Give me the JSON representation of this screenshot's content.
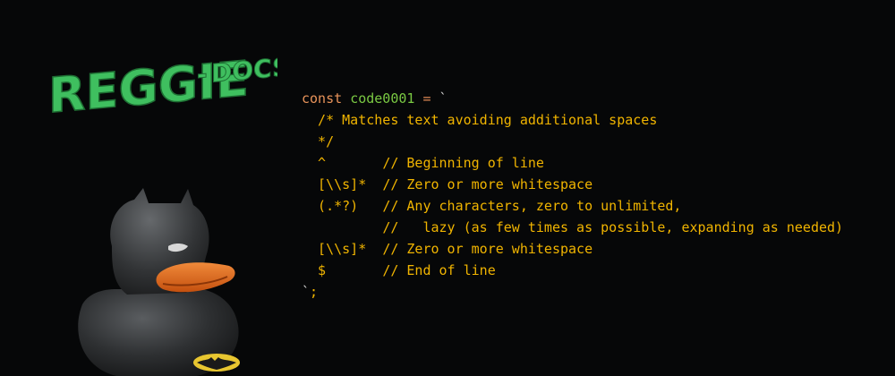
{
  "logo": {
    "text_main": "REGGIE",
    "text_dash": "-",
    "text_sub": "DOCS",
    "color": "#3fbf5f"
  },
  "code": {
    "header": {
      "keyword": "const",
      "identifier": "code0001",
      "operator": "=",
      "open_tick": "`"
    },
    "lines": [
      {
        "pattern": "  /* Matches text avoiding additional spaces",
        "comment": ""
      },
      {
        "pattern": "  */",
        "comment": ""
      },
      {
        "pattern": "  ^       ",
        "comment": "// Beginning of line"
      },
      {
        "pattern": "  [\\\\s]*  ",
        "comment": "// Zero or more whitespace"
      },
      {
        "pattern": "  (.*?)   ",
        "comment": "// Any characters, zero to unlimited,"
      },
      {
        "pattern": "          ",
        "comment": "//   lazy (as few times as possible, expanding as needed)"
      },
      {
        "pattern": "  [\\\\s]*  ",
        "comment": "// Zero or more whitespace"
      },
      {
        "pattern": "  $       ",
        "comment": "// End of line"
      }
    ],
    "footer": {
      "close_tick": "`",
      "semicolon": ";"
    }
  },
  "colors": {
    "background": "#060708",
    "keyword": "#e8935a",
    "identifier": "#7ac943",
    "comment": "#f0b400",
    "duck_body": "#2e3032",
    "duck_beak": "#e0681c"
  },
  "mascot": {
    "icon": "batman-rubber-duck-icon"
  }
}
